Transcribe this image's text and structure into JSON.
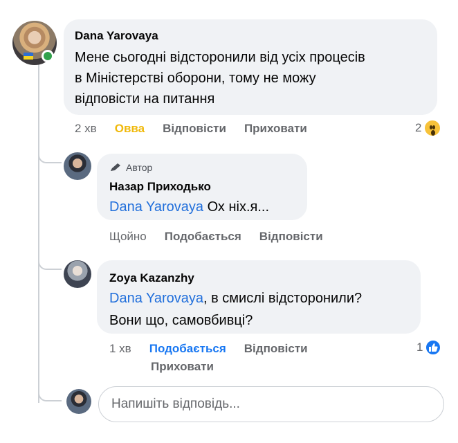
{
  "comment1": {
    "author": "Dana  Yarovaya",
    "lines": [
      "Мене сьогодні відсторонили від усіх процесів",
      "в Міністерстві оборони, тому не можу",
      "відповісти на питання"
    ],
    "time": "2 хв",
    "reaction_action": "Овва",
    "reply": "Відповісти",
    "hide": "Приховати",
    "reaction_count": "2",
    "reaction_icon": "wow-emoji-icon"
  },
  "reply1": {
    "badge": "Автор",
    "author": "Назар Приходько",
    "mention": "Dana  Yarovaya",
    "text": " Ох ніх.я...",
    "time": "Щойно",
    "like": "Подобається",
    "reply": "Відповісти"
  },
  "reply2": {
    "author": "Zoya Kazanzhy",
    "mention": "Dana  Yarovaya",
    "text_line1": ", в смислі відсторонили?",
    "text_line2": "Вони що, самовбивці?",
    "time": "1 хв",
    "like": "Подобається",
    "reply": "Відповісти",
    "hide": "Приховати",
    "reaction_count": "1",
    "reaction_icon": "like-icon"
  },
  "composer": {
    "placeholder": "Напишіть відповідь..."
  },
  "colors": {
    "bubble": "#f0f2f5",
    "mention": "#216fdb",
    "ova": "#f0b90b",
    "liked": "#1877f2",
    "online": "#31a24c"
  }
}
